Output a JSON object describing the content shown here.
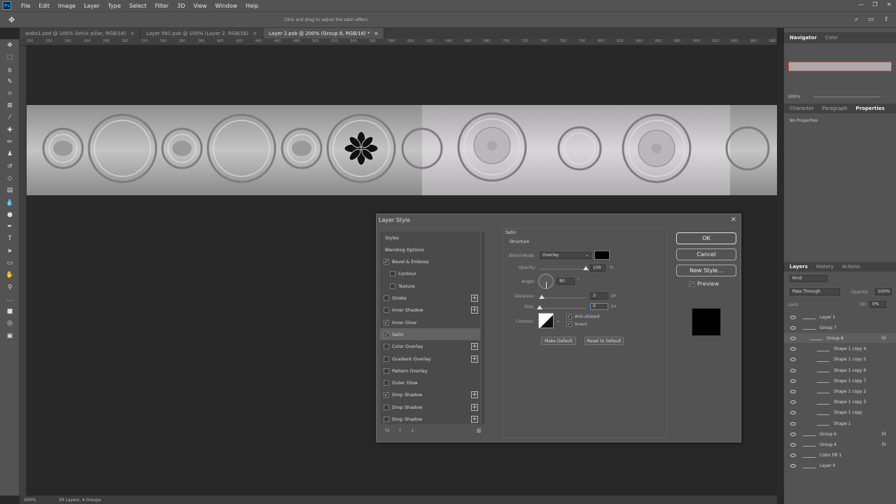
{
  "app": {
    "logo": "Ps"
  },
  "menu": [
    "File",
    "Edit",
    "Image",
    "Layer",
    "Type",
    "Select",
    "Filter",
    "3D",
    "View",
    "Window",
    "Help"
  ],
  "window_controls": [
    "—",
    "❐",
    "✕"
  ],
  "options_bar": {
    "hint": "Click and drag to adjust the satin effect."
  },
  "tabs": [
    {
      "label": "wako1.psd @ 100% (brick pillar, RGB/16)",
      "close": "×"
    },
    {
      "label": "Layer 591.psb @ 100% (Layer 2, RGB/16)",
      "close": "×"
    },
    {
      "label": "Layer 2.psb @ 200% (Group 8, RGB/16) *",
      "close": "×"
    }
  ],
  "ruler_ticks": [
    "200",
    "220",
    "240",
    "260",
    "280",
    "300",
    "320",
    "340",
    "360",
    "380",
    "400",
    "420",
    "440",
    "460",
    "480",
    "500",
    "520",
    "540",
    "560",
    "580",
    "600",
    "620",
    "640",
    "660",
    "680",
    "700",
    "720",
    "740",
    "760",
    "780",
    "800",
    "820",
    "840",
    "860",
    "880",
    "900",
    "920",
    "940",
    "960",
    "980"
  ],
  "status": {
    "zoom": "200%",
    "info": "29 Layers, 4 Groups"
  },
  "navigator": {
    "tabs": [
      "Navigator",
      "Color"
    ],
    "zoom": "200%"
  },
  "properties": {
    "tabs": [
      "Character",
      "Paragraph",
      "Properties"
    ],
    "empty": "No Properties"
  },
  "layers": {
    "tabs": [
      "Layers",
      "History",
      "Actions"
    ],
    "kind": "Kind",
    "blend": "Pass Through",
    "opacity_label": "Opacity:",
    "opacity": "100%",
    "lock_label": "Lock:",
    "fill_label": "Fill:",
    "fill": "0%",
    "rows": [
      {
        "name": "Layer 1",
        "indent": 0,
        "fx": ""
      },
      {
        "name": "Group 7",
        "indent": 0,
        "fx": ""
      },
      {
        "name": "Group 8",
        "indent": 1,
        "fx": "fx"
      },
      {
        "name": "Shape 1 copy 4",
        "indent": 2,
        "fx": ""
      },
      {
        "name": "Shape 1 copy 5",
        "indent": 2,
        "fx": ""
      },
      {
        "name": "Shape 1 copy 6",
        "indent": 2,
        "fx": ""
      },
      {
        "name": "Shape 1 copy 7",
        "indent": 2,
        "fx": ""
      },
      {
        "name": "Shape 1 copy 2",
        "indent": 2,
        "fx": ""
      },
      {
        "name": "Shape 1 copy 3",
        "indent": 2,
        "fx": ""
      },
      {
        "name": "Shape 1 copy",
        "indent": 2,
        "fx": ""
      },
      {
        "name": "Shape 1",
        "indent": 2,
        "fx": ""
      },
      {
        "name": "Group 6",
        "indent": 0,
        "fx": "fx"
      },
      {
        "name": "Group 4",
        "indent": 0,
        "fx": "fx"
      },
      {
        "name": "Color Fill 1",
        "indent": 0,
        "fx": ""
      },
      {
        "name": "Layer 0",
        "indent": 0,
        "fx": ""
      }
    ]
  },
  "dialog": {
    "title": "Layer Style",
    "styles": [
      {
        "label": "Styles",
        "checkbox": false,
        "checked": false,
        "plus": false,
        "sub": false
      },
      {
        "label": "Blending Options",
        "checkbox": false,
        "checked": false,
        "plus": false,
        "sub": false
      },
      {
        "label": "Bevel & Emboss",
        "checkbox": true,
        "checked": true,
        "plus": false,
        "sub": false
      },
      {
        "label": "Contour",
        "checkbox": true,
        "checked": false,
        "plus": false,
        "sub": true
      },
      {
        "label": "Texture",
        "checkbox": true,
        "checked": false,
        "plus": false,
        "sub": true
      },
      {
        "label": "Stroke",
        "checkbox": true,
        "checked": false,
        "plus": true,
        "sub": false
      },
      {
        "label": "Inner Shadow",
        "checkbox": true,
        "checked": false,
        "plus": true,
        "sub": false
      },
      {
        "label": "Inner Glow",
        "checkbox": true,
        "checked": true,
        "plus": false,
        "sub": false
      },
      {
        "label": "Satin",
        "checkbox": true,
        "checked": true,
        "plus": false,
        "sub": false,
        "selected": true
      },
      {
        "label": "Color Overlay",
        "checkbox": true,
        "checked": false,
        "plus": true,
        "sub": false
      },
      {
        "label": "Gradient Overlay",
        "checkbox": true,
        "checked": false,
        "plus": true,
        "sub": false
      },
      {
        "label": "Pattern Overlay",
        "checkbox": true,
        "checked": false,
        "plus": false,
        "sub": false
      },
      {
        "label": "Outer Glow",
        "checkbox": true,
        "checked": false,
        "plus": false,
        "sub": false
      },
      {
        "label": "Drop Shadow",
        "checkbox": true,
        "checked": true,
        "plus": true,
        "sub": false
      },
      {
        "label": "Drop Shadow",
        "checkbox": true,
        "checked": false,
        "plus": true,
        "sub": false
      },
      {
        "label": "Drop Shadow",
        "checkbox": true,
        "checked": false,
        "plus": true,
        "sub": false
      }
    ],
    "footer_icons": [
      "fx",
      "↑",
      "↓",
      "🗑"
    ],
    "section": "Satin",
    "structure": "Structure",
    "blend_mode_label": "Blend Mode:",
    "blend_mode": "Overlay",
    "opacity_label": "Opacity:",
    "opacity": "100",
    "opacity_level": 1.0,
    "pct": "%",
    "angle_label": "Angle:",
    "angle": "90",
    "deg": "°",
    "distance_label": "Distance:",
    "distance": "3",
    "distance_level": 0.05,
    "size_label": "Size:",
    "size": "0",
    "size_level": 0.0,
    "px": "px",
    "contour_label": "Contour:",
    "anti_aliased": "Anti-aliased",
    "invert": "Invert",
    "make_default": "Make Default",
    "reset_default": "Reset to Default",
    "ok": "OK",
    "cancel": "Cancel",
    "new_style": "New Style...",
    "preview": "Preview",
    "close": "×"
  }
}
